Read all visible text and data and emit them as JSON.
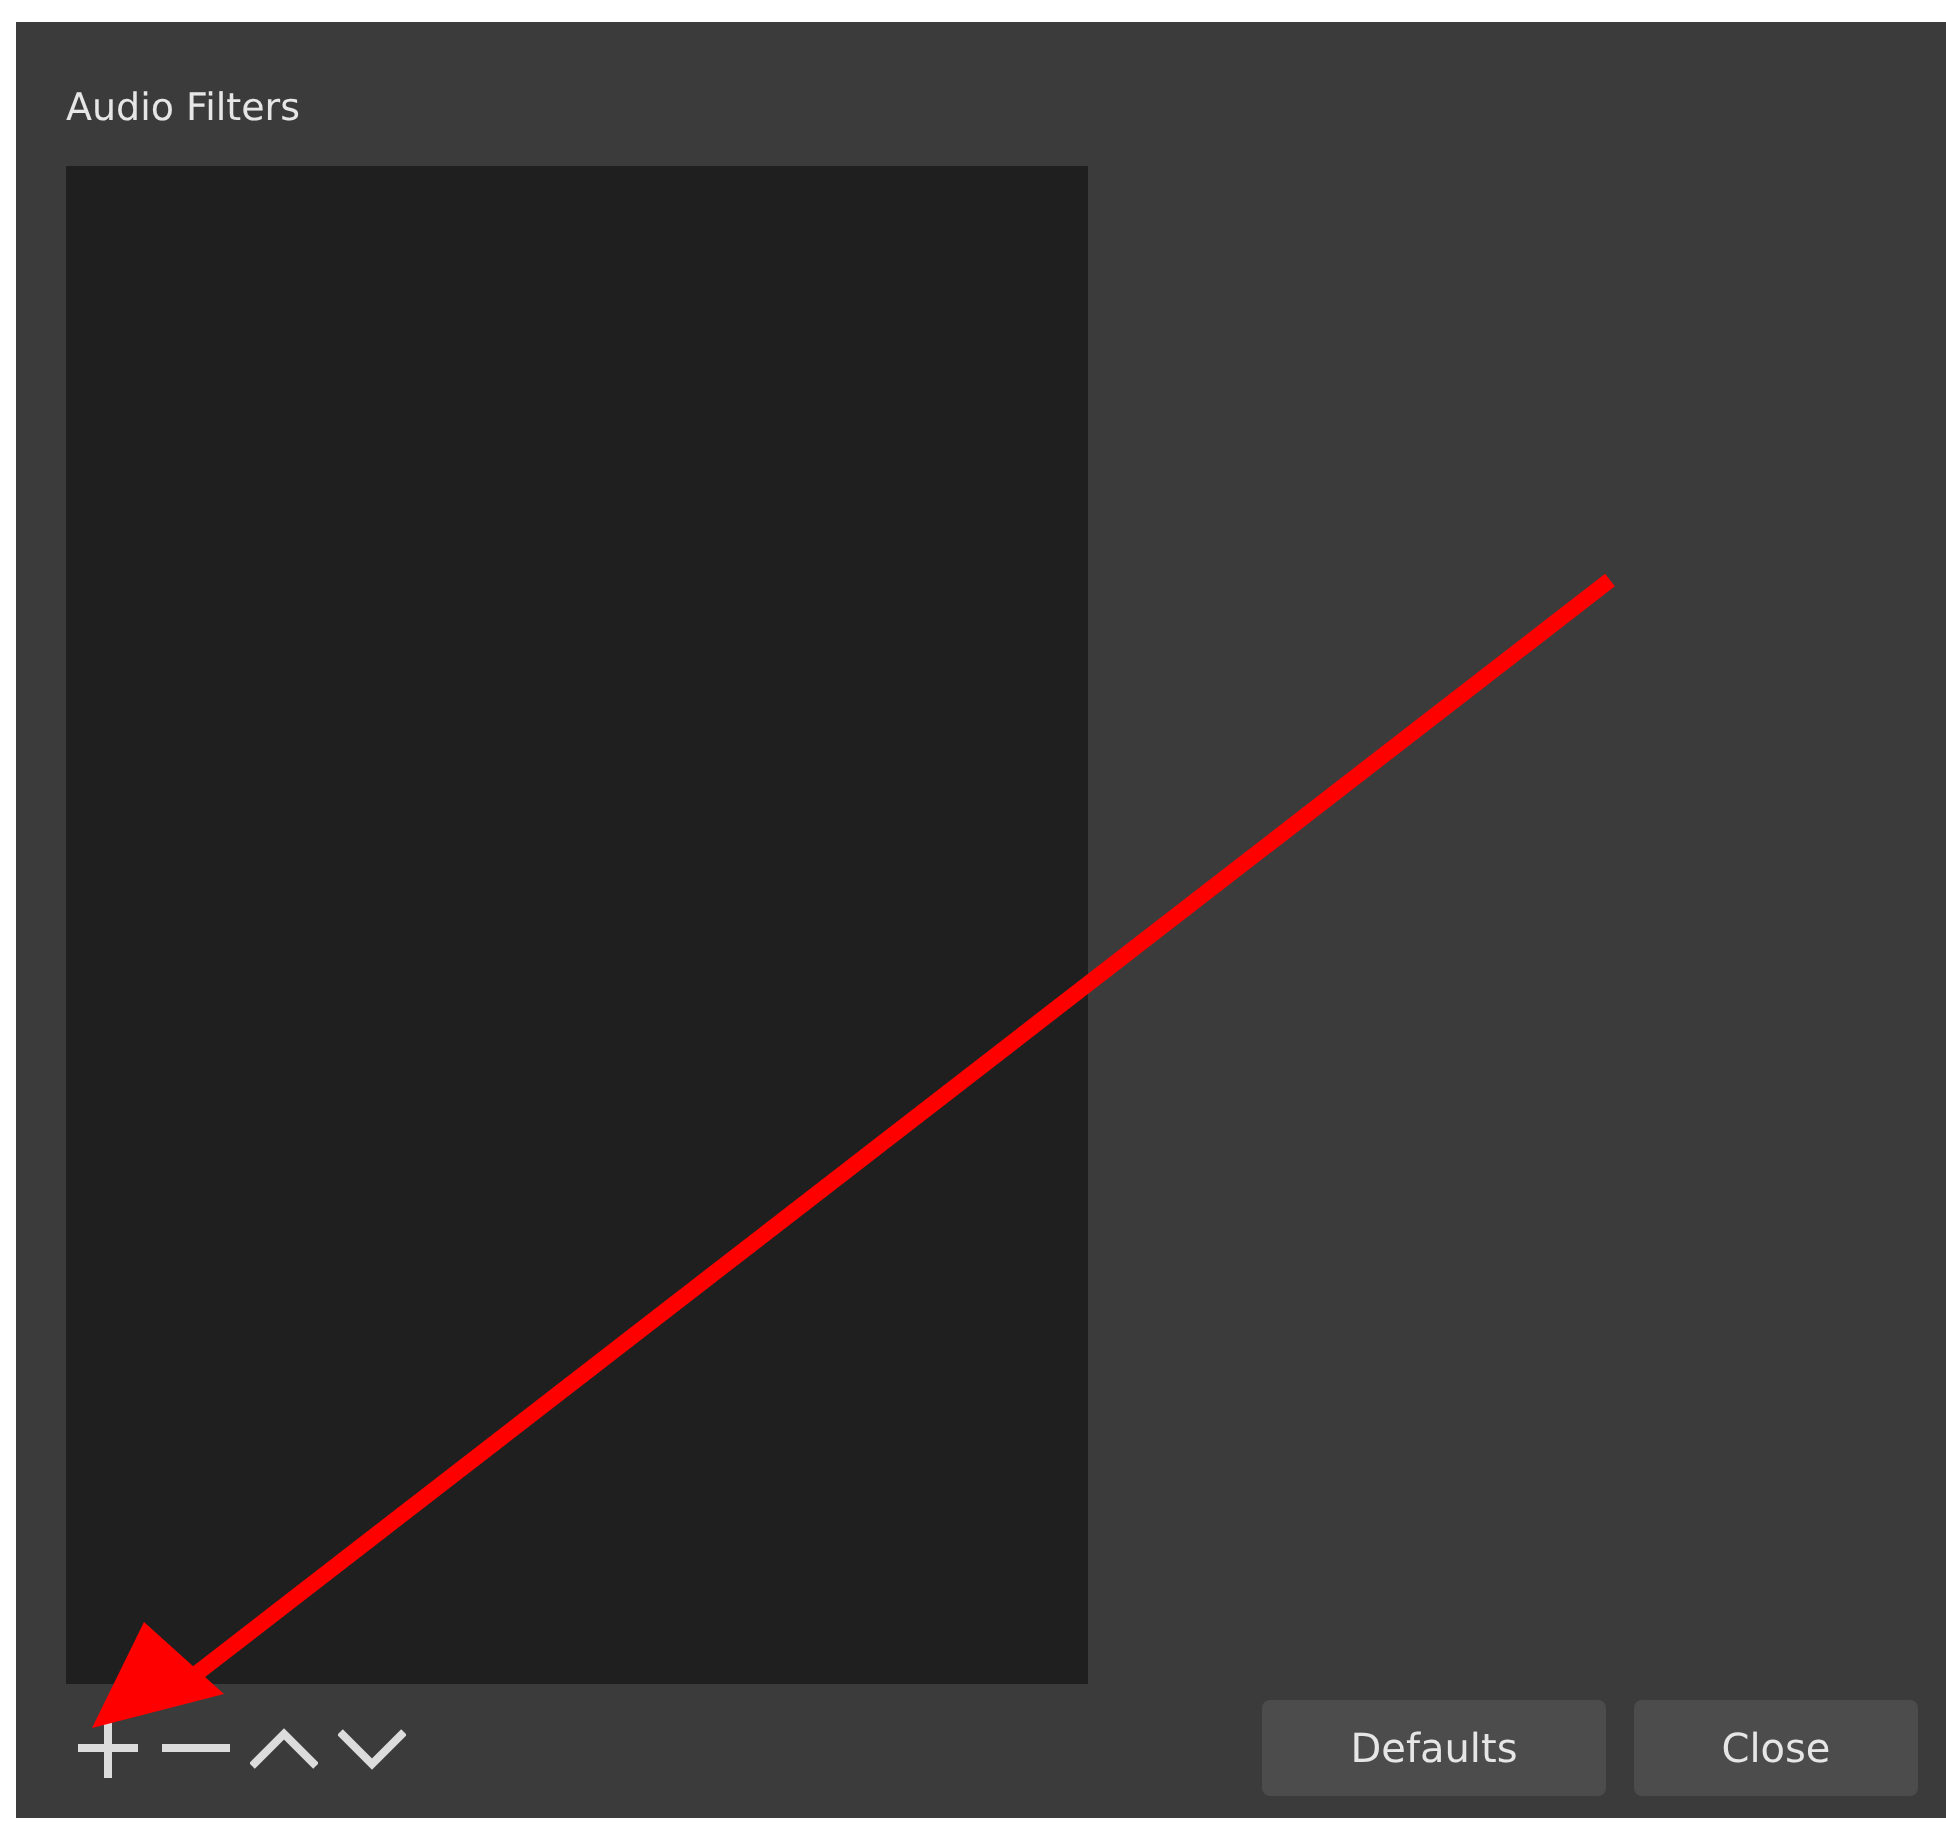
{
  "title": "Audio Filters",
  "toolbar": [
    {
      "kind": "add"
    },
    {
      "kind": "remove"
    },
    {
      "kind": "up"
    },
    {
      "kind": "down"
    }
  ],
  "buttons": [
    {
      "label": "Defaults"
    },
    {
      "label": "Close"
    }
  ]
}
